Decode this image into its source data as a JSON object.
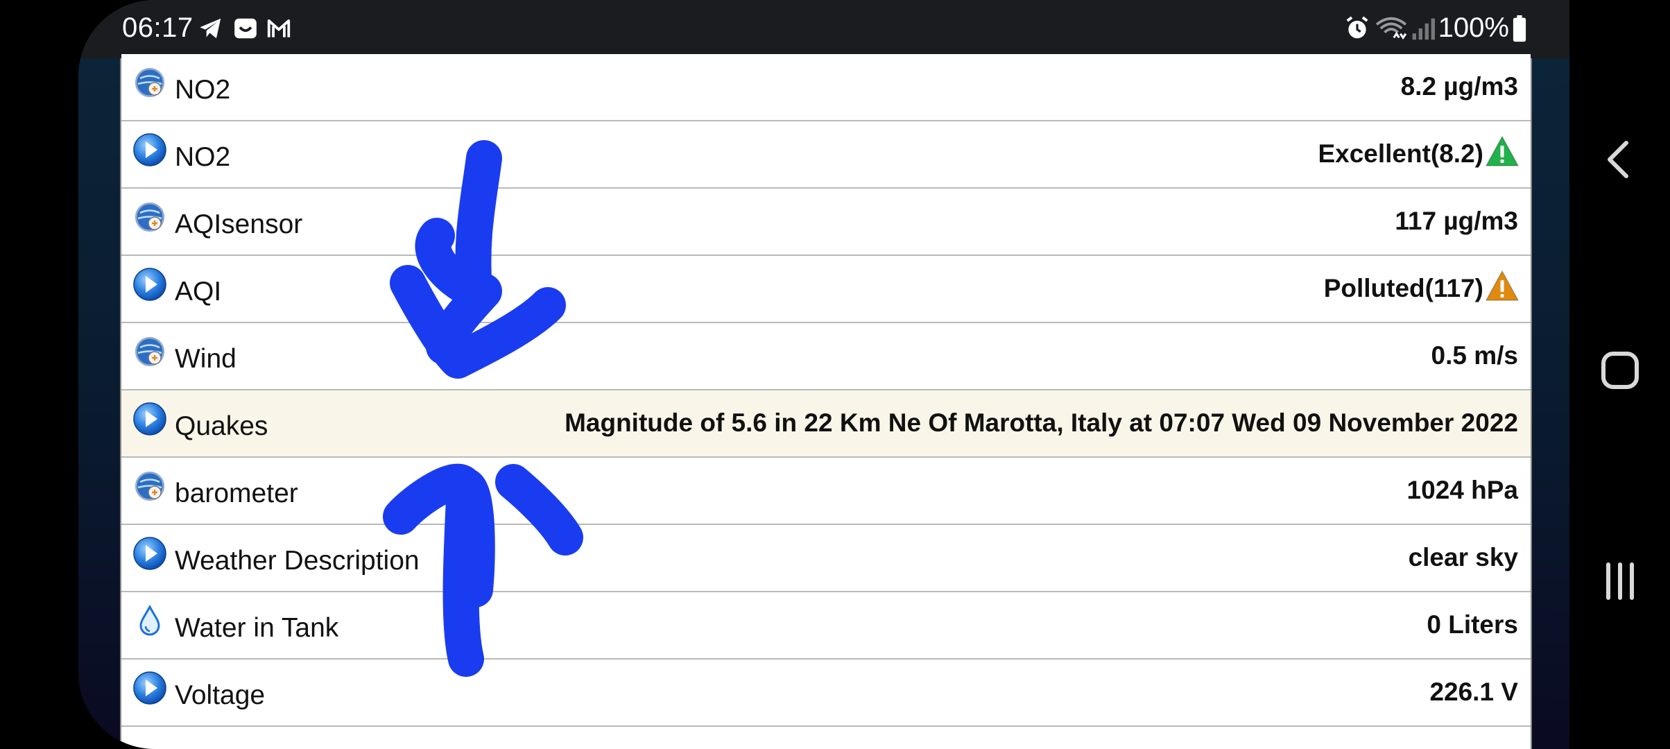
{
  "status_bar": {
    "time": "06:17",
    "left_icons": [
      "telegram-icon",
      "inbox-icon",
      "gmail-icon"
    ],
    "right_icons": [
      "alarm-icon",
      "wifi-icon",
      "signal-icon",
      "battery-icon"
    ],
    "battery_text": "100%"
  },
  "table": {
    "rows": [
      {
        "label": "NO2",
        "value": "8.2 µg/m3",
        "icon": "sensor-globe-icon"
      },
      {
        "label": "NO2",
        "value": "Excellent(8.2)",
        "icon": "play-icon",
        "status_icon": "warning-green-icon"
      },
      {
        "label": "AQIsensor",
        "value": "117 µg/m3",
        "icon": "sensor-globe-icon"
      },
      {
        "label": "AQI",
        "value": "Polluted(117)",
        "icon": "play-icon",
        "status_icon": "warning-orange-icon"
      },
      {
        "label": "Wind",
        "value": "0.5 m/s",
        "icon": "sensor-globe-icon"
      },
      {
        "label": "Quakes",
        "value": "Magnitude of 5.6 in 22 Km Ne Of Marotta, Italy at 07:07 Wed 09 November 2022",
        "icon": "play-icon",
        "highlighted": true
      },
      {
        "label": "barometer",
        "value": "1024 hPa",
        "icon": "sensor-globe-icon"
      },
      {
        "label": "Weather Description",
        "value": "clear sky",
        "icon": "play-icon"
      },
      {
        "label": "Water in Tank",
        "value": "0 Liters",
        "icon": "water-drop-icon"
      },
      {
        "label": "Voltage",
        "value": "226.1 V",
        "icon": "play-icon"
      }
    ]
  },
  "nav_bar": {
    "buttons": [
      "back-icon",
      "home-icon",
      "recents-icon"
    ]
  },
  "colors": {
    "annotation_blue": "#1a3cf0",
    "highlight_row": "#f9f6e9",
    "warning_green": "#22b14c",
    "warning_orange": "#e08a12"
  }
}
